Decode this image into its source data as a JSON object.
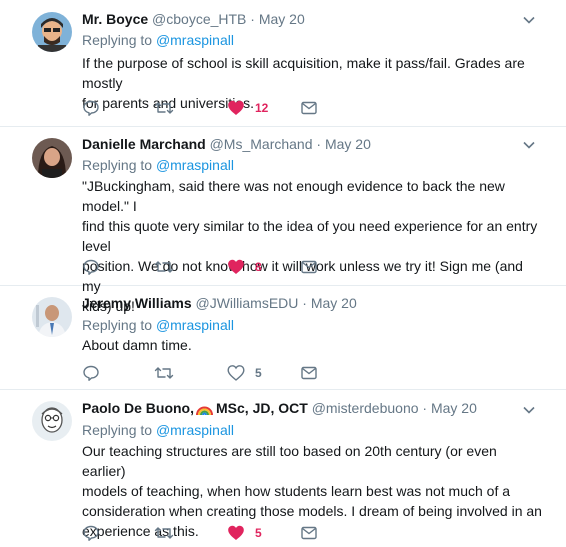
{
  "tweets": [
    {
      "name": "Mr. Boyce",
      "handle": "@cboyce_HTB",
      "sep": "·",
      "date": "May 20",
      "replying_prefix": "Replying to",
      "replying_handle": "@mraspinall",
      "lines": [
        "If the purpose of school is skill acquisition, make it pass/fail. Grades are mostly",
        "for parents and universities."
      ],
      "like_count": "12",
      "liked": true
    },
    {
      "name": "Danielle Marchand",
      "handle": "@Ms_Marchand",
      "sep": "·",
      "date": "May 20",
      "replying_prefix": "Replying to",
      "replying_handle": "@mraspinall",
      "lines": [
        "\"JBuckingham, said there was not enough evidence to back the new model.\" I",
        "find this quote very similar to the idea of you need experience for an entry level",
        "position. We do not know how it will work unless we try it! Sign me (and my",
        "kids) up!"
      ],
      "like_count": "8",
      "liked": true
    },
    {
      "name": "Jeremy Williams",
      "handle": "@JWilliamsEDU",
      "sep": "·",
      "date": "May 20",
      "replying_prefix": "Replying to",
      "replying_handle": "@mraspinall",
      "lines": [
        "About damn time."
      ],
      "like_count": "5",
      "liked": false
    },
    {
      "name": "Paolo De Buono,",
      "name_suffix": "MSc, JD, OCT",
      "handle": "@misterdebuono",
      "sep": "·",
      "date": "May 20",
      "replying_prefix": "Replying to",
      "replying_handle": "@mraspinall",
      "lines": [
        "Our teaching structures are still too based on 20th century (or even earlier)",
        "models of teaching, when how students learn best was not much of a",
        "consideration when creating those models. I dream of being involved in an",
        "experience as this."
      ],
      "like_count": "5",
      "liked": true
    }
  ],
  "icons": {
    "reply": "reply-icon",
    "retweet": "retweet-icon",
    "like": "heart-icon",
    "dm": "direct-message-icon",
    "menu": "chevron-down-icon",
    "emoji": "rainbow-icon"
  },
  "colors": {
    "like_active": "#e0245e",
    "link": "#1b95e0",
    "muted": "#657786",
    "divider": "#e6ecf0"
  }
}
